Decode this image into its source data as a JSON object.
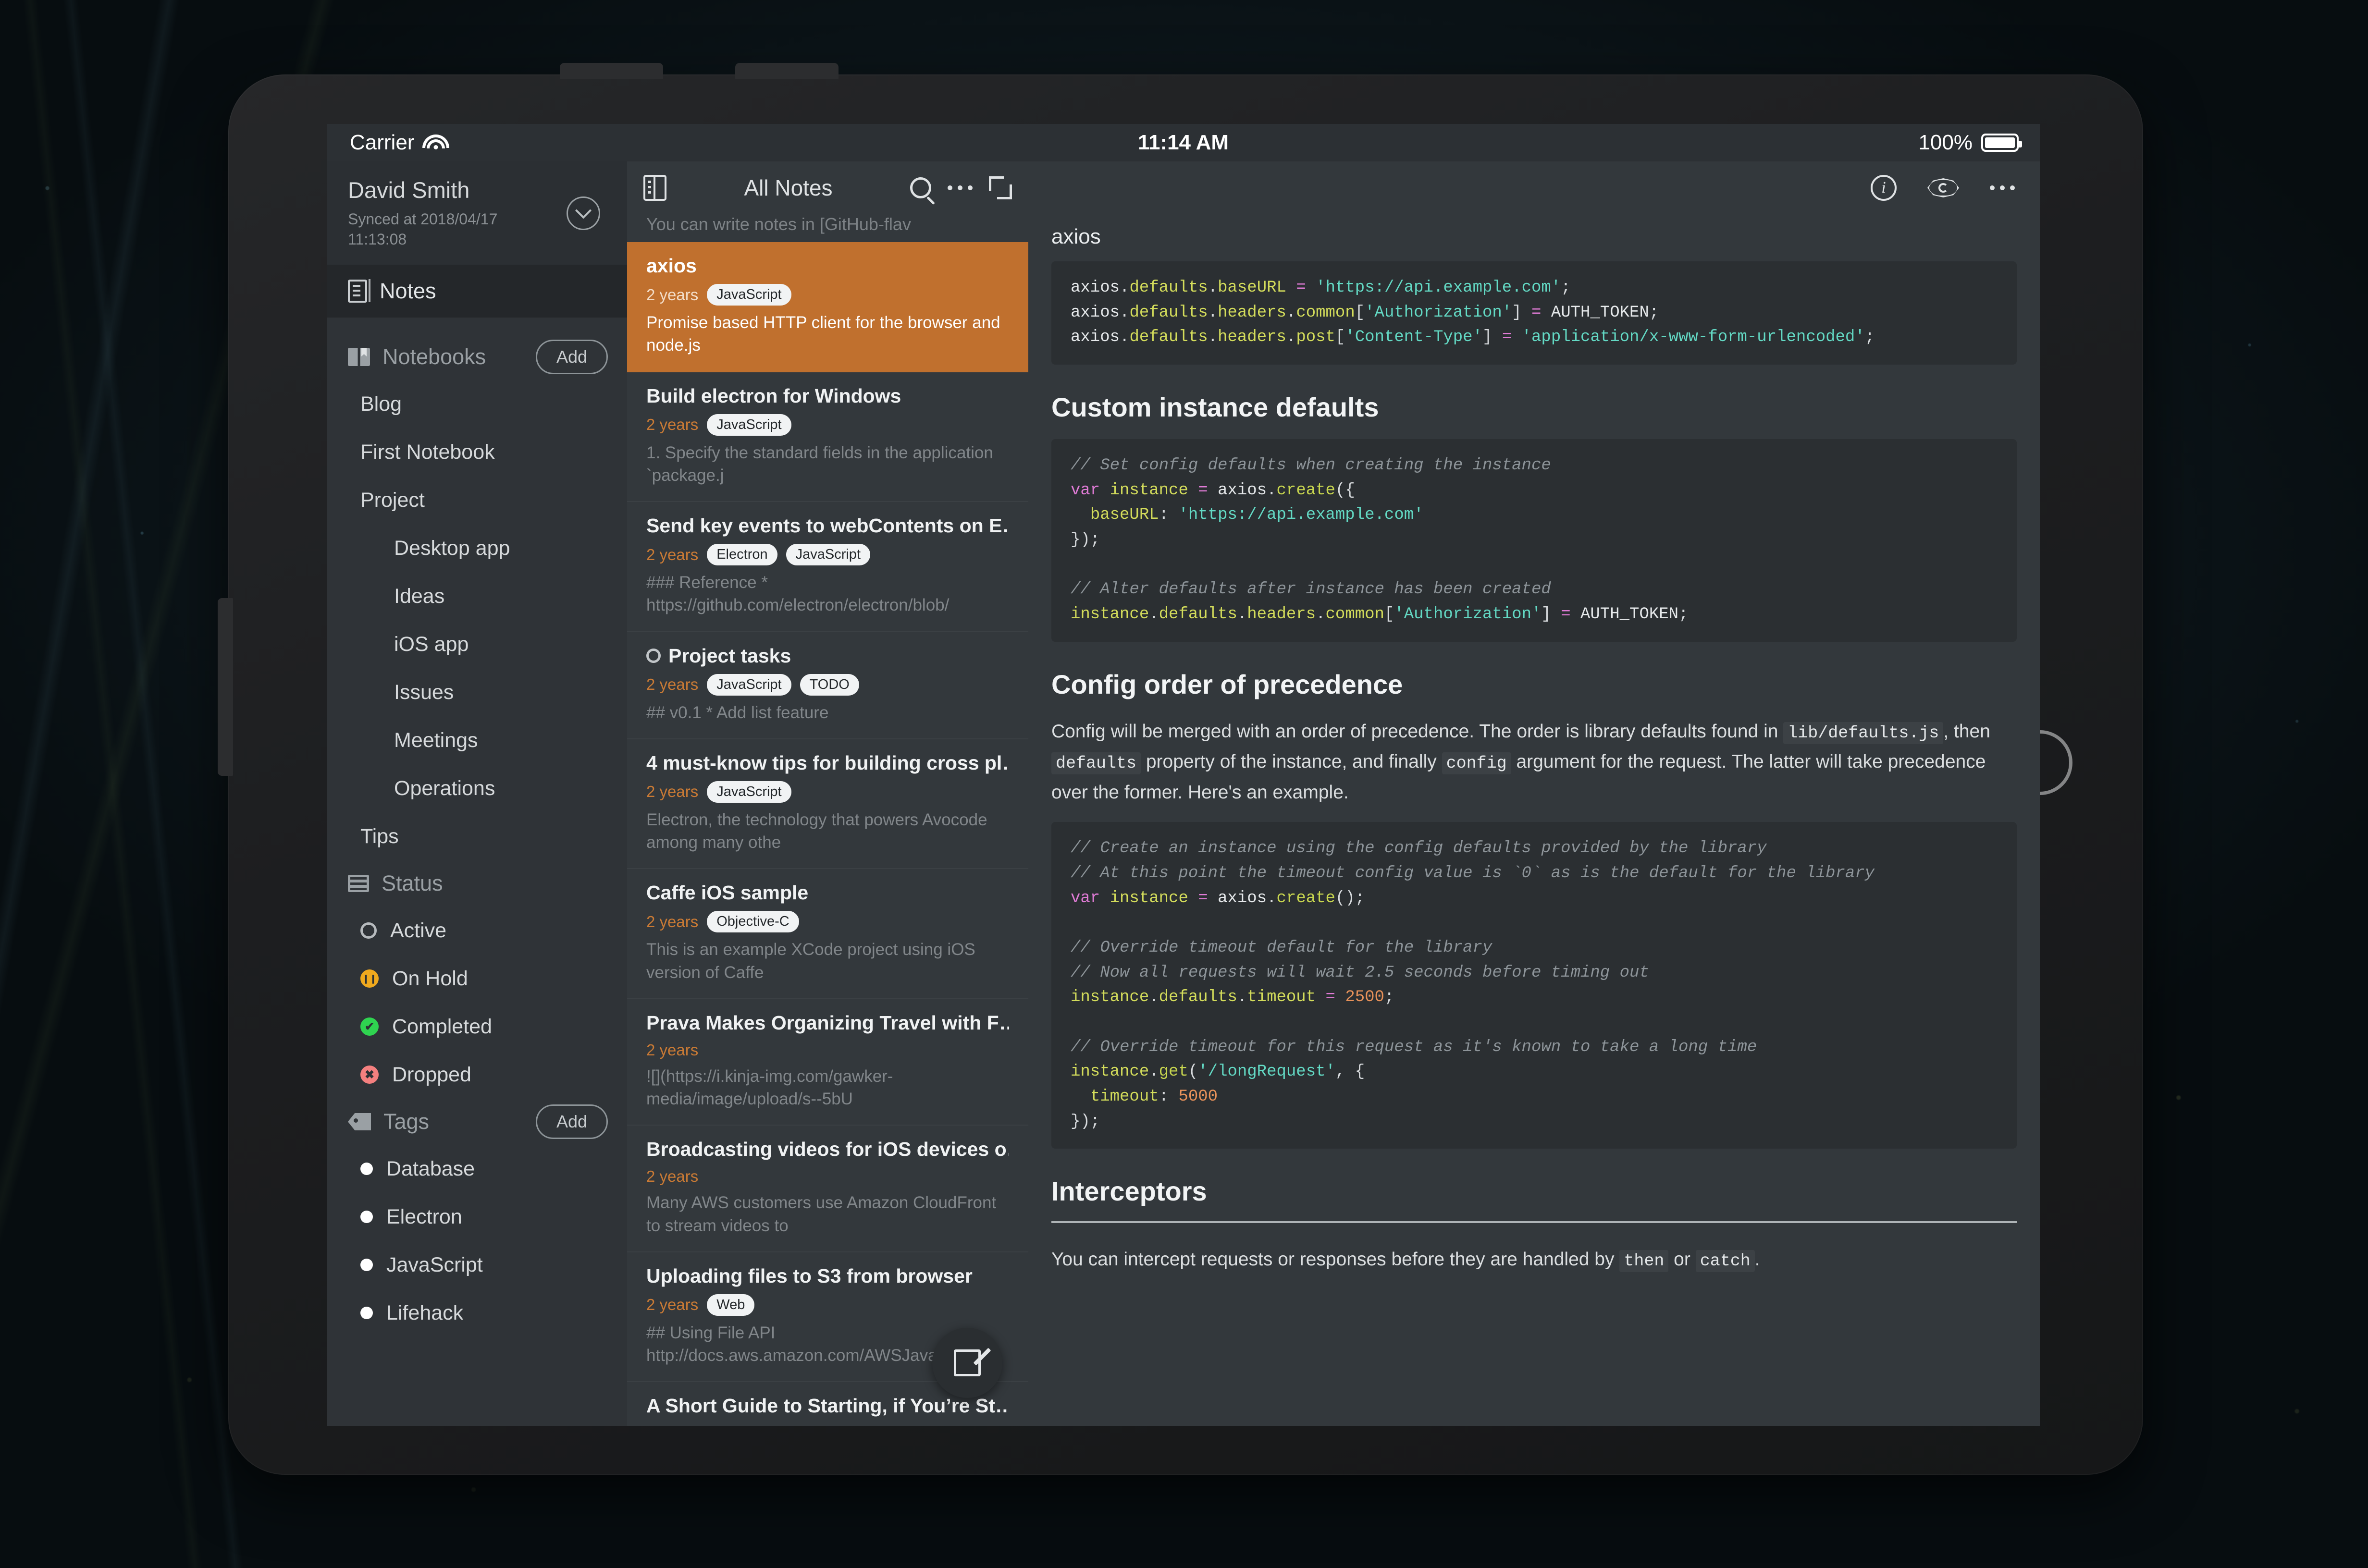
{
  "device": {
    "home_button": "home-button",
    "hardware_buttons": [
      "power-button",
      "volume-button",
      "side-button"
    ]
  },
  "statusbar": {
    "carrier": "Carrier",
    "wifi_icon": "wifi-icon",
    "time": "11:14 AM",
    "battery_percent": "100%",
    "battery_icon": "battery-icon"
  },
  "sidebar": {
    "account": {
      "name": "David Smith",
      "sync": "Synced at 2018/04/17\n11:13:08",
      "chevron_icon": "chevron-down-icon"
    },
    "notes_row": {
      "label": "Notes",
      "icon": "notes-icon"
    },
    "notebooks": {
      "label": "Notebooks",
      "icon": "book-icon",
      "add_label": "Add",
      "items": [
        {
          "label": "Blog",
          "level": 1
        },
        {
          "label": "First Notebook",
          "level": 1
        },
        {
          "label": "Project",
          "level": 1
        },
        {
          "label": "Desktop app",
          "level": 2
        },
        {
          "label": "Ideas",
          "level": 2
        },
        {
          "label": "iOS app",
          "level": 2
        },
        {
          "label": "Issues",
          "level": 2
        },
        {
          "label": "Meetings",
          "level": 2
        },
        {
          "label": "Operations",
          "level": 2
        },
        {
          "label": "Tips",
          "level": 1
        }
      ]
    },
    "status": {
      "label": "Status",
      "icon": "status-list-icon",
      "items": [
        {
          "label": "Active",
          "icon": "circle-outline-icon",
          "color": "#b6babd"
        },
        {
          "label": "On Hold",
          "icon": "pause-icon",
          "color": "#f0a91e"
        },
        {
          "label": "Completed",
          "icon": "check-icon",
          "color": "#2fd450"
        },
        {
          "label": "Dropped",
          "icon": "x-icon",
          "color": "#f4807f"
        }
      ]
    },
    "tags": {
      "label": "Tags",
      "icon": "tag-icon",
      "add_label": "Add",
      "items": [
        {
          "label": "Database",
          "color": "#ffffff"
        },
        {
          "label": "Electron",
          "color": "#ffffff"
        },
        {
          "label": "JavaScript",
          "color": "#ffffff"
        },
        {
          "label": "Lifehack",
          "color": "#ffffff"
        }
      ]
    }
  },
  "notelist": {
    "toolbar": {
      "panel_icon": "sidebar-toggle-icon",
      "title": "All Notes",
      "search_icon": "search-icon",
      "more_icon": "more-dots-icon",
      "expand_icon": "expand-icon"
    },
    "peek_text": "You can write notes in [GitHub-flav",
    "compose_icon": "compose-icon",
    "selected_color": "#c0702e",
    "age_color": "#c97a35",
    "notes": [
      {
        "title": "axios",
        "age": "2 years",
        "tags": [
          "JavaScript"
        ],
        "preview": "Promise based HTTP client for the browser and node.js",
        "selected": true,
        "has_status_ring": false
      },
      {
        "title": "Build electron for Windows",
        "age": "2 years",
        "tags": [
          "JavaScript"
        ],
        "preview": "1. Specify the standard fields in the application `package.j",
        "selected": false,
        "has_status_ring": false
      },
      {
        "title": "Send key events to webContents on E…",
        "age": "2 years",
        "tags": [
          "Electron",
          "JavaScript"
        ],
        "preview": "### Reference\n * https://github.com/electron/electron/blob/",
        "selected": false,
        "has_status_ring": false
      },
      {
        "title": "Project tasks",
        "age": "2 years",
        "tags": [
          "JavaScript",
          "TODO"
        ],
        "preview": "## v0.1\n * Add list feature",
        "selected": false,
        "has_status_ring": true
      },
      {
        "title": "4 must-know tips for building cross pl…",
        "age": "2 years",
        "tags": [
          "JavaScript"
        ],
        "preview": "Electron, the technology that powers Avocode among many othe",
        "selected": false,
        "has_status_ring": false
      },
      {
        "title": "Caffe iOS sample",
        "age": "2 years",
        "tags": [
          "Objective-C"
        ],
        "preview": "This is an example XCode project using iOS version of Caffe",
        "selected": false,
        "has_status_ring": false
      },
      {
        "title": "Prava Makes Organizing Travel with F…",
        "age": "2 years",
        "tags": [],
        "preview": "![](https://i.kinja-img.com/gawker-media/image/upload/s--5bU",
        "selected": false,
        "has_status_ring": false
      },
      {
        "title": "Broadcasting videos for iOS devices o…",
        "age": "2 years",
        "tags": [],
        "preview": "Many AWS customers use Amazon CloudFront to stream videos to",
        "selected": false,
        "has_status_ring": false
      },
      {
        "title": "Uploading files to S3 from browser",
        "age": "2 years",
        "tags": [
          "Web"
        ],
        "preview": "## Using File API\nhttp://docs.aws.amazon.com/AWSJavaScriptS",
        "selected": false,
        "has_status_ring": false
      },
      {
        "title": "A Short Guide to Starting, if You’re St…",
        "age": "",
        "tags": [],
        "preview": "",
        "selected": false,
        "has_status_ring": false
      }
    ]
  },
  "editor": {
    "toolbar": {
      "info_icon": "info-icon",
      "preview_icon": "eye-icon",
      "more_icon": "more-dots-icon"
    },
    "note_title": "axios",
    "blocks": [
      {
        "type": "code",
        "id": "code_defaults"
      },
      {
        "type": "h2",
        "id": "h_custom"
      },
      {
        "type": "code",
        "id": "code_instance"
      },
      {
        "type": "h2",
        "id": "h_precedence"
      },
      {
        "type": "p",
        "id": "p_precedence"
      },
      {
        "type": "code",
        "id": "code_timeout"
      },
      {
        "type": "h2",
        "id": "h_interceptors"
      },
      {
        "type": "p",
        "id": "p_interceptors"
      }
    ],
    "h_custom": "Custom instance defaults",
    "h_precedence": "Config order of precedence",
    "h_interceptors": "Interceptors",
    "p_precedence_1": "Config will be merged with an order of precedence. The order is library defaults found in ",
    "p_precedence_code1": "lib/defaults.js",
    "p_precedence_2": ", then ",
    "p_precedence_code2": "defaults",
    "p_precedence_3": " property of the instance, and finally ",
    "p_precedence_code3": "config",
    "p_precedence_4": " argument for the request. The latter will take precedence over the former. Here's an example.",
    "p_interceptors_1": "You can intercept requests or responses before they are handled by ",
    "p_interceptors_code1": "then",
    "p_interceptors_2": " or ",
    "p_interceptors_code2": "catch",
    "p_interceptors_3": ".",
    "code_defaults_lines": [
      "axios.defaults.baseURL = 'https://api.example.com';",
      "axios.defaults.headers.common['Authorization'] = AUTH_TOKEN;",
      "axios.defaults.headers.post['Content-Type'] = 'application/x-www-form-urlencoded';"
    ],
    "code_instance_lines": [
      "// Set config defaults when creating the instance",
      "var instance = axios.create({",
      "  baseURL: 'https://api.example.com'",
      "});",
      "",
      "// Alter defaults after instance has been created",
      "instance.defaults.headers.common['Authorization'] = AUTH_TOKEN;"
    ],
    "code_timeout_lines": [
      "// Create an instance using the config defaults provided by the library",
      "// At this point the timeout config value is `0` as is the default for the library",
      "var instance = axios.create();",
      "",
      "// Override timeout default for the library",
      "// Now all requests will wait 2.5 seconds before timing out",
      "instance.defaults.timeout = 2500;",
      "",
      "// Override timeout for this request as it's known to take a long time",
      "instance.get('/longRequest', {",
      "  timeout: 5000",
      "});"
    ]
  }
}
